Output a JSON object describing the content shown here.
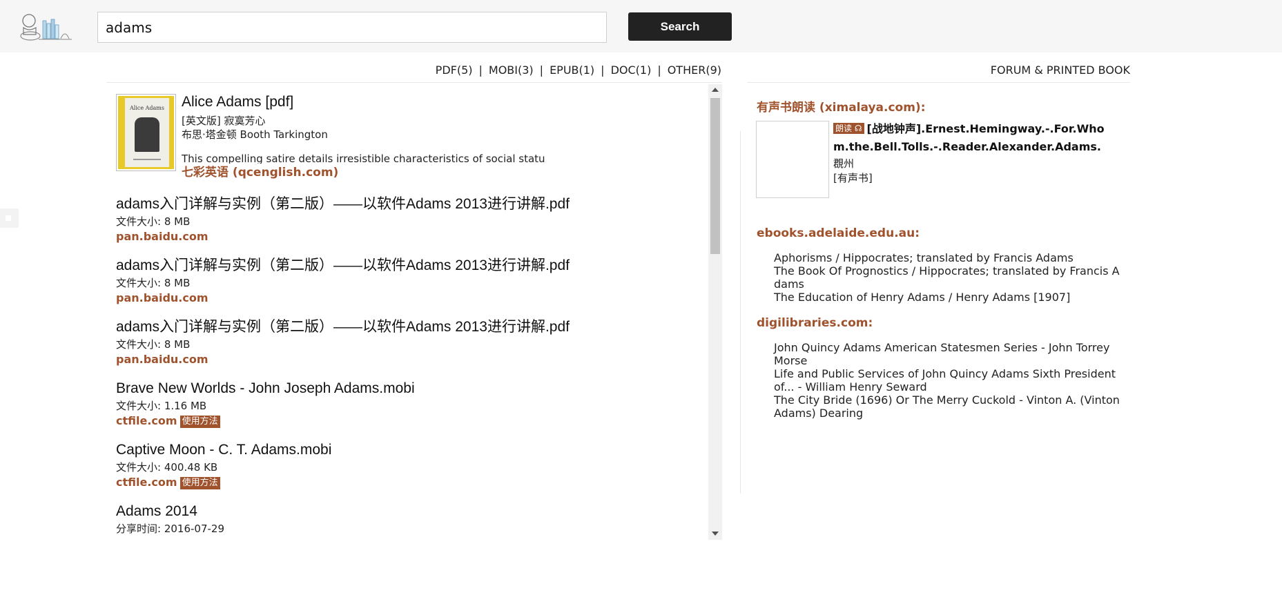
{
  "header": {
    "search_value": "adams",
    "search_button": "Search"
  },
  "filters": {
    "pdf": "PDF(5)",
    "mobi": "MOBI(3)",
    "epub": "EPUB(1)",
    "doc": "DOC(1)",
    "other": "OTHER(9)",
    "separator": "|"
  },
  "forum_link": "FORUM & PRINTED BOOK",
  "featured": {
    "cover_title": "Alice Adams",
    "title": "Alice Adams [pdf]",
    "line1": "[英文版] 寂寞芳心",
    "line2": "布思·塔金顿 Booth Tarkington",
    "description": "This compelling satire details irresistible characteristics of social statu",
    "source": "七彩英语 (qcenglish.com)"
  },
  "results": [
    {
      "title": "adams入门详解与实例（第二版）——以软件Adams 2013进行讲解.pdf",
      "meta": "文件大小: 8 MB",
      "source": "pan.baidu.com",
      "badge": ""
    },
    {
      "title": "adams入门详解与实例（第二版）——以软件Adams 2013进行讲解.pdf",
      "meta": "文件大小: 8 MB",
      "source": "pan.baidu.com",
      "badge": ""
    },
    {
      "title": "adams入门详解与实例（第二版）——以软件Adams 2013进行讲解.pdf",
      "meta": "文件大小: 8 MB",
      "source": "pan.baidu.com",
      "badge": ""
    },
    {
      "title": "Brave New Worlds - John Joseph Adams.mobi",
      "meta": "文件大小: 1.16 MB",
      "source": "ctfile.com",
      "badge": "使用方法"
    },
    {
      "title": "Captive Moon - C. T. Adams.mobi",
      "meta": "文件大小: 400.48 KB",
      "source": "ctfile.com",
      "badge": "使用方法"
    },
    {
      "title": "Adams 2014",
      "meta": "分享时间: 2016-07-29",
      "source": "",
      "badge": ""
    }
  ],
  "audio_section": {
    "heading": "有声书朗读 (ximalaya.com):",
    "badge": "朗读",
    "title": "[战地钟声].Ernest.Hemingway.-.For.Whom.the.Bell.Tolls.-.Reader.Alexander.Adams.",
    "author": "覠州",
    "tag": "[有声书]"
  },
  "adelaide_section": {
    "heading": "ebooks.adelaide.edu.au:",
    "items": [
      "Aphorisms / Hippocrates; translated by Francis Adams",
      "The Book Of Prognostics / Hippocrates; translated by Francis Adams",
      "The Education of Henry Adams / Henry Adams [1907]"
    ]
  },
  "digilibraries_section": {
    "heading": "digilibraries.com:",
    "items": [
      "John Quincy Adams American Statesmen Series - John Torrey Morse",
      "Life and Public Services of John Quincy Adams Sixth President of... - William Henry Seward",
      "The City Bride (1696) Or The Merry Cuckold - Vinton A. (Vinton Adams) Dearing"
    ]
  },
  "colors": {
    "accent": "#a0522d",
    "button": "#222222",
    "header_bg": "#f6f6f6"
  }
}
